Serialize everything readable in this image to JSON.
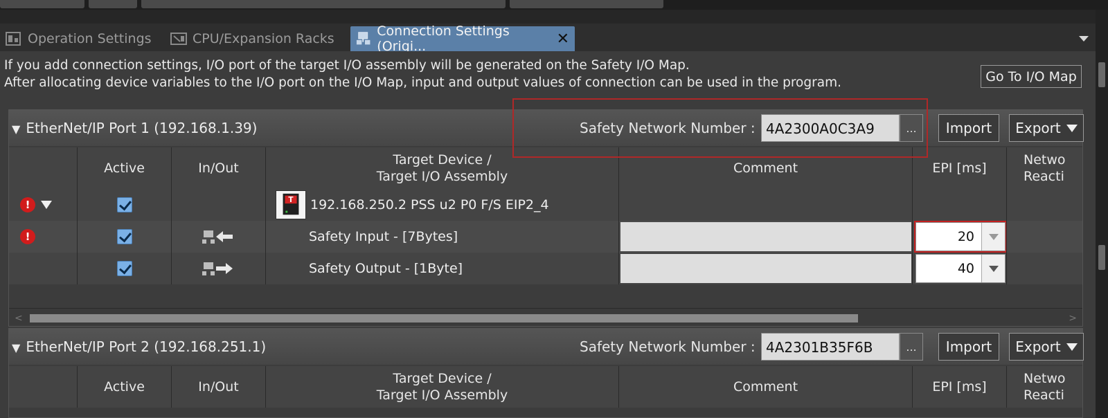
{
  "tabs": [
    {
      "label": "Operation Settings",
      "icon": "operation-settings-icon",
      "active": false
    },
    {
      "label": "CPU/Expansion Racks",
      "icon": "cpu-racks-icon",
      "active": false
    },
    {
      "label": "Connection Settings (Origi...",
      "icon": "connection-icon",
      "active": true
    }
  ],
  "close_glyph": "✕",
  "info": {
    "line1": "If you add connection settings, I/O port of the target I/O assembly will be generated on the Safety I/O Map.",
    "line2": "After allocating device variables to the I/O port on the I/O Map, input and output values of connection can be used in the program."
  },
  "goto_button": "Go To I/O Map",
  "columns": {
    "active": "Active",
    "inout": "In/Out",
    "target_line1": "Target Device /",
    "target_line2": "Target I/O Assembly",
    "comment": "Comment",
    "epi": "EPI [ms]",
    "network_line1": "Netwo",
    "network_line2": "Reacti"
  },
  "sn_label": "Safety Network Number :",
  "browse_label": "...",
  "import_label": "Import",
  "export_label": "Export",
  "ports": [
    {
      "title": "EtherNet/IP Port 1 (192.168.1.39)",
      "safety_network_number": "4A2300A0C3A9",
      "device": {
        "name": "192.168.250.2 PSS u2 P0 F/S EIP2_4",
        "device_icon_letter": "T"
      },
      "rows": [
        {
          "assembly": "Safety Input - [7Bytes]",
          "direction": "input",
          "epi": "20"
        },
        {
          "assembly": "Safety Output - [1Byte]",
          "direction": "output",
          "epi": "40"
        }
      ]
    },
    {
      "title": "EtherNet/IP Port 2 (192.168.251.1)",
      "safety_network_number": "4A2301B35F6B"
    }
  ],
  "colors": {
    "active_tab": "#5b80a8",
    "error": "#d11c1c",
    "highlight": "#b02828",
    "checkbox": "#7ab0e6"
  }
}
